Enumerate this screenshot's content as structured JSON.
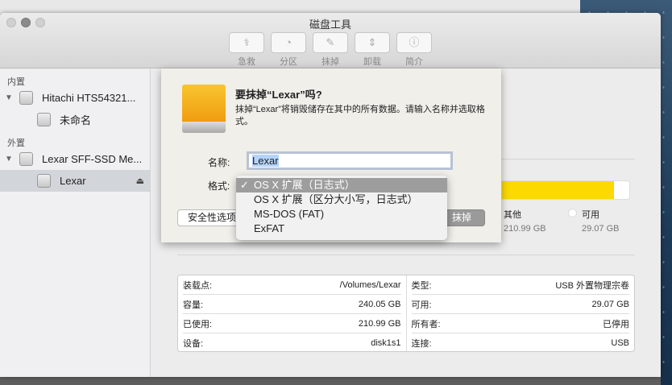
{
  "window": {
    "title": "磁盘工具"
  },
  "toolbar": [
    {
      "label": "急救",
      "icon": "stethoscope-icon",
      "glyph": "⚕"
    },
    {
      "label": "分区",
      "icon": "partition-icon",
      "glyph": "◔"
    },
    {
      "label": "抹掉",
      "icon": "erase-icon",
      "glyph": "✎"
    },
    {
      "label": "卸载",
      "icon": "unmount-icon",
      "glyph": "⇕"
    },
    {
      "label": "简介",
      "icon": "info-icon",
      "glyph": "ⓘ"
    }
  ],
  "sidebar": {
    "internal": "内置",
    "external": "外置",
    "items": [
      {
        "label": "Hitachi HTS54321..."
      },
      {
        "label": "未命名"
      },
      {
        "label": "Lexar SFF-SSD Me..."
      },
      {
        "label": "Lexar"
      }
    ]
  },
  "dialog": {
    "heading": "要抹掉“Lexar”吗?",
    "description": "抹掉“Lexar”将销毁储存在其中的所有数据。请输入名称并选取格式。",
    "name_label": "名称:",
    "name_value": "Lexar",
    "format_label": "格式:",
    "security_button": "安全性选项...",
    "erase_button": "抹掉"
  },
  "format_menu": {
    "options": [
      "OS X 扩展（日志式）",
      "OS X 扩展（区分大小写，日志式）",
      "MS-DOS (FAT)",
      "ExFAT"
    ],
    "selected": 0,
    "check": "✓"
  },
  "usage": {
    "used_fraction": 0.879,
    "legend": [
      {
        "label": "其他",
        "value": "210.99 GB",
        "color": "#fcd900"
      },
      {
        "label": "可用",
        "value": "29.07 GB",
        "color": "#ffffff"
      }
    ]
  },
  "info": {
    "left": [
      {
        "k": "装载点:",
        "v": "/Volumes/Lexar"
      },
      {
        "k": "容量:",
        "v": "240.05 GB"
      },
      {
        "k": "已使用:",
        "v": "210.99 GB"
      },
      {
        "k": "设备:",
        "v": "disk1s1"
      }
    ],
    "right": [
      {
        "k": "类型:",
        "v": "USB 外置物理宗卷"
      },
      {
        "k": "可用:",
        "v": "29.07 GB"
      },
      {
        "k": "所有者:",
        "v": "已停用"
      },
      {
        "k": "连接:",
        "v": "USB"
      }
    ]
  }
}
